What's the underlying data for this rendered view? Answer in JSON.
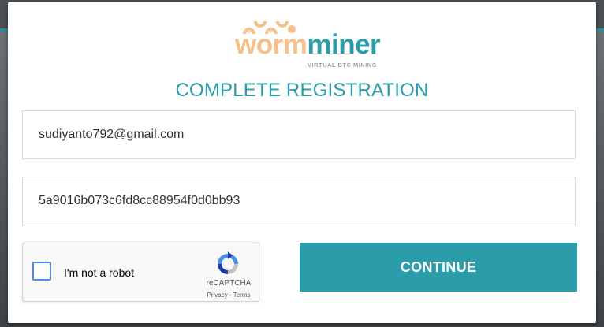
{
  "brand": {
    "name_part1": "worm",
    "name_part2": "miner",
    "tagline": "VIRTUAL BTC MINING",
    "colors": {
      "orange": "#f7c08b",
      "teal": "#2a9caa"
    }
  },
  "form": {
    "title": "COMPLETE REGISTRATION",
    "email_value": "sudiyanto792@gmail.com",
    "key_value": "5a9016b073c6fd8cc88954f0d0bb93",
    "continue_label": "CONTINUE"
  },
  "captcha": {
    "label": "I'm not a robot",
    "brand": "reCAPTCHA",
    "privacy": "Privacy",
    "separator": " - ",
    "terms": "Terms",
    "icon": "recaptcha-icon"
  }
}
